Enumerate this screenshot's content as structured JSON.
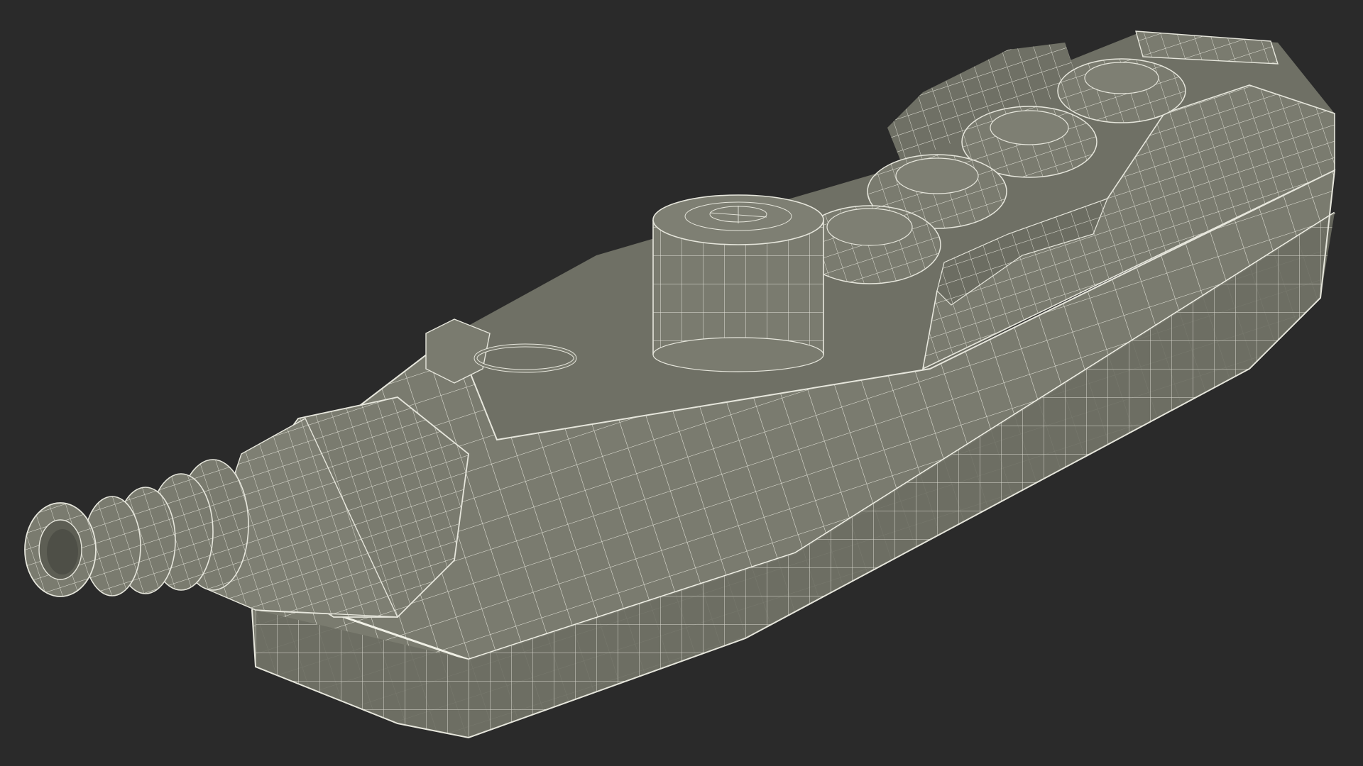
{
  "scene": {
    "subject": "pendant-control-wireframe",
    "background_color": "#2a2a2a",
    "mesh_face_color": "#7a7b6f",
    "mesh_face_shade": "#6c6d62",
    "mesh_face_dark": "#5d5e54",
    "wire_color": "#e6e6dc",
    "buttons": [
      {
        "name": "push-button-1"
      },
      {
        "name": "push-button-2"
      },
      {
        "name": "push-button-3"
      },
      {
        "name": "push-button-4"
      }
    ],
    "has_emergency_knob": true,
    "has_cable_gland": true,
    "has_hanging_ring": true
  }
}
